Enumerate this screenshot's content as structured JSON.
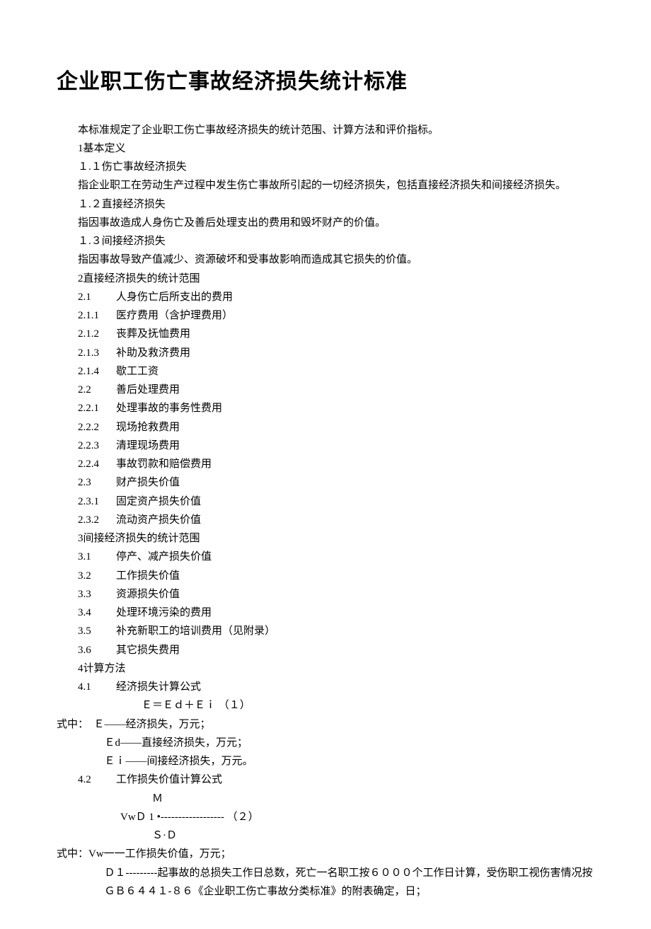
{
  "title": "企业职工伤亡事故经济损失统计标准",
  "intro": "本标准规定了企业职工伤亡事故经济损失的统计范围、计算方法和评价指标。",
  "s1": {
    "h": "1基本定义",
    "i11_h": "１.１伤亡事故经济损失",
    "i11_t": "指企业职工在劳动生产过程中发生伤亡事故所引起的一切经济损失，包括直接经济损失和间接经济损失。",
    "i12_h": "１.２直接经济损失",
    "i12_t": "指因事故造成人身伤亡及善后处理支出的费用和毁坏财产的价值。",
    "i13_h": "１.３间接经济损失",
    "i13_t": "指因事故导致产值减少、资源破坏和受事故影响而造成其它损失的价值。"
  },
  "s2": {
    "h": "2直接经济损失的统计范围",
    "items": [
      {
        "idx": "2.1",
        "label": "人身伤亡后所支出的费用"
      },
      {
        "idx": "2.1.1",
        "label": "医疗费用（含护理费用）"
      },
      {
        "idx": "2.1.2",
        "label": "丧葬及抚恤费用"
      },
      {
        "idx": "2.1.3",
        "label": "补助及救济费用"
      },
      {
        "idx": "2.1.4",
        "label": "歇工工资"
      },
      {
        "idx": "2.2",
        "label": "善后处理费用"
      },
      {
        "idx": "2.2.1",
        "label": "处理事故的事务性费用"
      },
      {
        "idx": "2.2.2",
        "label": "现场抢救费用"
      },
      {
        "idx": "2.2.3",
        "label": "清理现场费用"
      },
      {
        "idx": "2.2.4",
        "label": "事故罚款和赔偿费用"
      },
      {
        "idx": "2.3",
        "label": "财产损失价值"
      },
      {
        "idx": "2.3.1",
        "label": "固定资产损失价值"
      },
      {
        "idx": "2.3.2",
        "label": "流动资产损失价值"
      }
    ]
  },
  "s3": {
    "h": "3间接经济损失的统计范围",
    "items": [
      {
        "idx": "3.1",
        "label": "停产、减产损失价值"
      },
      {
        "idx": "3.2",
        "label": "工作损失价值"
      },
      {
        "idx": "3.3",
        "label": "资源损失价值"
      },
      {
        "idx": "3.4",
        "label": "处理环境污染的费用"
      },
      {
        "idx": "3.5",
        "label": "补充新职工的培训费用（见附录）"
      },
      {
        "idx": "3.6",
        "label": "其它损失费用"
      }
    ]
  },
  "s4": {
    "h": "4计算方法",
    "i41": {
      "idx": "4.1",
      "label": "经济损失计算公式"
    },
    "formula1": "Ｅ＝Ｅｄ＋Ｅｉ （１）",
    "exp_head": "式中：　Ｅ——经济损失，万元；",
    "exp_ed": "Ｅd——直接经济损失，万元；",
    "exp_ei": "Ｅｉ——间接经济损失，万元。",
    "i42": {
      "idx": "4.2",
      "label": "工作损失价值计算公式"
    },
    "frac_num": "Ｍ",
    "frac_line": "VwＤ 1 •------------------ （２）",
    "frac_den": "Ｓ·Ｄ",
    "exp2_head": "式中：Vw一一工作损失价值，万元；",
    "exp2_d1": "Ｄ１---------起事故的总损失工作日总数，死亡一名职工按６０００个工作日计算，受伤职工视伤害情况按ＧＢ６４４１-８６《企业职工伤亡事故分类标准》的附表确定，日；"
  }
}
